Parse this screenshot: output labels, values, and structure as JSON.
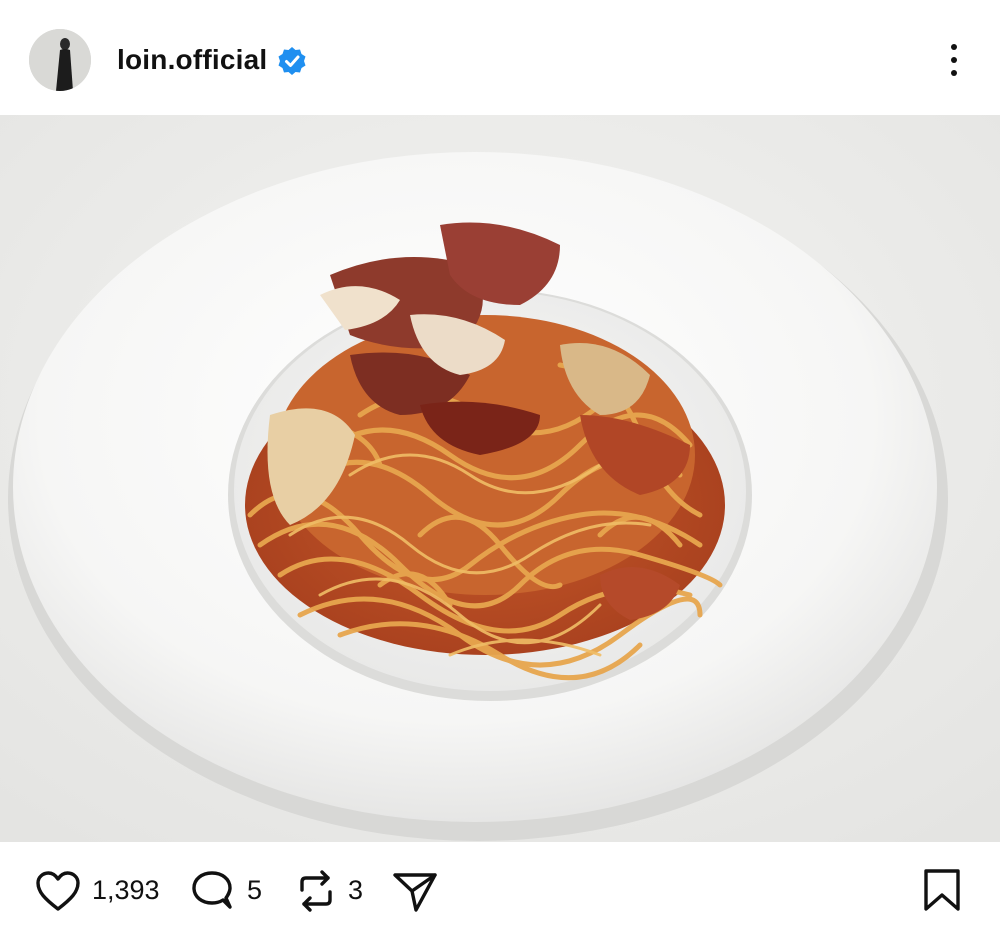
{
  "post": {
    "username": "loin.official",
    "verified": true,
    "header_icons": [
      "avatar",
      "verified-badge-icon",
      "more-options-icon"
    ]
  },
  "image": {
    "subject": "pasta-photo"
  },
  "stats": {
    "likes": "1,393",
    "comments": "5",
    "reposts": "3"
  },
  "icons": {
    "like": "heart-icon",
    "comment": "comment-bubble-icon",
    "repost": "repost-icon",
    "share": "send-icon",
    "save": "bookmark-icon"
  },
  "colors": {
    "verified_blue": "#1f8ff0",
    "text": "#111111",
    "background": "#ffffff"
  }
}
